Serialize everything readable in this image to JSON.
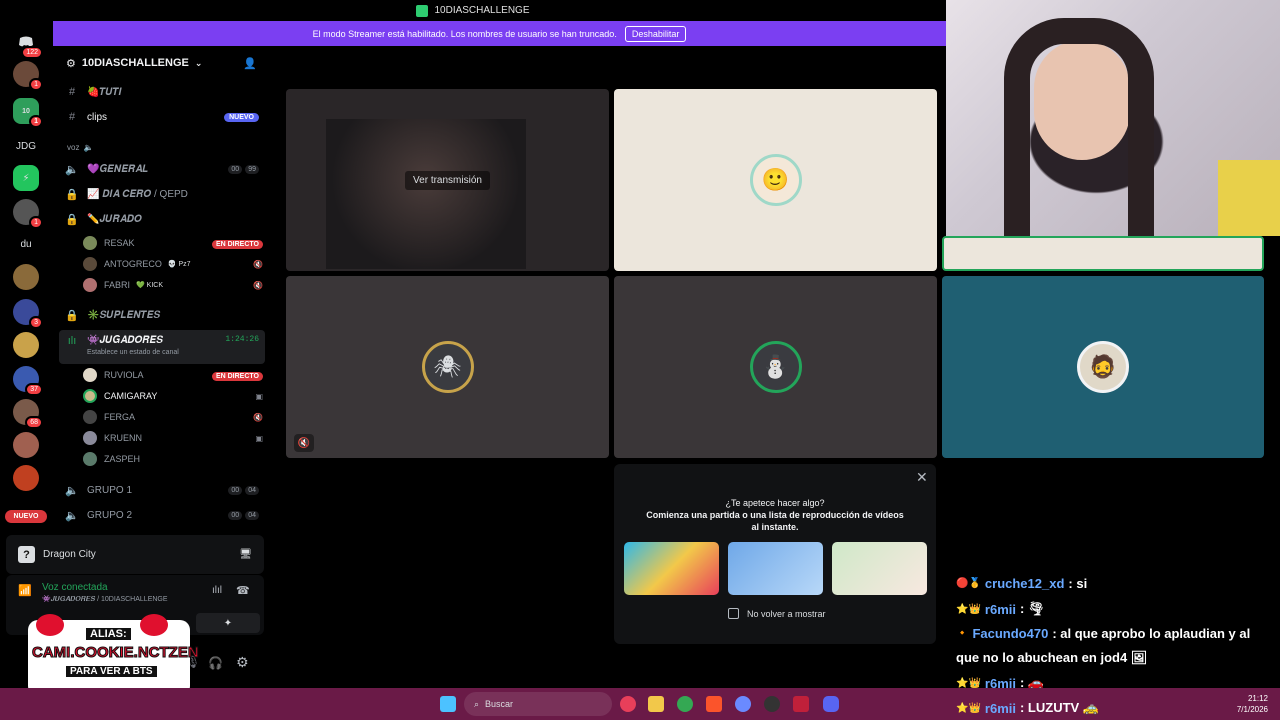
{
  "window": {
    "title": "10DIASCHALLENGE"
  },
  "banner": {
    "text": "El modo Streamer está habilitado. Los nombres de usuario se han truncado.",
    "button": "Deshabilitar"
  },
  "rail": {
    "badges": {
      "home": "122",
      "s1": "1",
      "s2": "3",
      "s3": "1",
      "s4": "3",
      "s5": "37",
      "s6": "68"
    },
    "labels": {
      "jdg": "JDG",
      "du": "du",
      "nuevo": "NUEVO"
    }
  },
  "sidebar": {
    "server_name": "10DIASCHALLENGE",
    "channels": {
      "tuti": "🍓𝑻𝑼𝑻𝑰",
      "clips": "clips",
      "clips_badge": "NUEVO",
      "voz_label": "voz",
      "general": "💜𝑮𝑬𝑵𝑬𝑹𝑨𝑳",
      "general_count1": "00",
      "general_count2": "99",
      "diacero": "📈 𝑫𝑰𝑨 𝑪𝑬𝑹𝑶 / QEPD",
      "jurado": "✏️𝑱𝑼𝑹𝑨𝑫𝑶",
      "suplentes": "✳️𝑺𝑼𝑷𝑳𝑬𝑵𝑻𝑬𝑺",
      "jugadores": "👾𝑱𝑼𝑮𝑨𝑫𝑶𝑹𝑬𝑺",
      "jugadores_time": "1:24:26",
      "jugadores_status": "Establece un estado de canal",
      "grupo1": "GRUPO 1",
      "grupo2": "GRUPO 2",
      "count00": "00",
      "count04": "04"
    },
    "jurado_users": [
      {
        "name": "RESAK",
        "tag": "EN DIRECTO"
      },
      {
        "name": "ANTOGRECO",
        "tag": "💀 Pz7"
      },
      {
        "name": "FABRI",
        "tag": "💚 KICK"
      }
    ],
    "jugadores_users": [
      {
        "name": "RUVIOLA",
        "tag": "EN DIRECTO"
      },
      {
        "name": "CAMIGARAY",
        "tag": ""
      },
      {
        "name": "FERGA",
        "tag": ""
      },
      {
        "name": "KRUENN",
        "tag": ""
      },
      {
        "name": "ZASPEH",
        "tag": ""
      }
    ],
    "activity": "Dragon City",
    "voice": {
      "status": "Voz conectada",
      "channel": "👾𝑱𝑼𝑮𝑨𝑫𝑶𝑹𝑬𝑺 / 10DIASCHALLENGE"
    }
  },
  "grid": {
    "watch_stream": "Ver transmisión"
  },
  "popup": {
    "title": "¿Te apetece hacer algo?",
    "subtitle": "Comienza una partida o una lista de reproducción de vídeos al instante.",
    "checkbox": "No volver a mostrar"
  },
  "sticker": {
    "line1": "ALIAS:",
    "line2": "CAMI.COOKIE.NCTZEN",
    "line3": "PARA VER A BTS"
  },
  "chat": [
    {
      "name": "cruche12_xd",
      "msg": ": si"
    },
    {
      "name": "r6mii",
      "msg": ": 🌪"
    },
    {
      "name": "Facundo470",
      "msg": ": al que aprobo lo aplaudian y al"
    },
    {
      "name": "",
      "msg": "que no lo abuchean en jod4 🖼"
    },
    {
      "name": "r6mii",
      "msg": ": 🚗"
    },
    {
      "name": "r6mii",
      "msg": ": LUZUTV 🚕"
    }
  ],
  "taskbar": {
    "search": "Buscar",
    "time": "21:12",
    "date": "7/1/2026"
  },
  "colors": {
    "banner": "#7b3ff2",
    "live": "#da373c",
    "new_badge": "#5865f2",
    "taskbar": "#6a1a47"
  }
}
